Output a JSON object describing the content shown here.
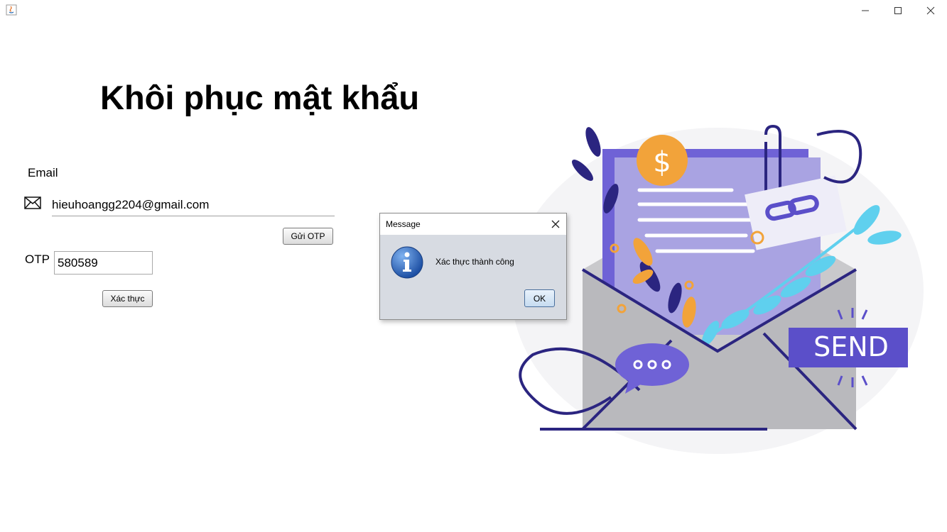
{
  "window": {
    "minimize_icon": "minimize-icon",
    "maximize_icon": "maximize-icon",
    "close_icon": "close-icon"
  },
  "form": {
    "title": "Khôi phục mật khẩu",
    "email_label": "Email",
    "email_value": "hieuhoangg2204@gmail.com",
    "send_otp_label": "Gửi OTP",
    "otp_label": "OTP",
    "otp_value": "580589",
    "verify_label": "Xác thực"
  },
  "illustration": {
    "send_text": "SEND",
    "dollar_text": "$"
  },
  "dialog": {
    "title": "Message",
    "message": "Xác thực thành công",
    "ok_label": "OK",
    "icon": "info-icon"
  },
  "colors": {
    "purple": "#5b4fc9",
    "navy": "#2b2580",
    "orange": "#f2a33a",
    "cyan": "#5fd0ee",
    "gray": "#b9b9bd",
    "dialog_bg": "#d7dbe2"
  }
}
